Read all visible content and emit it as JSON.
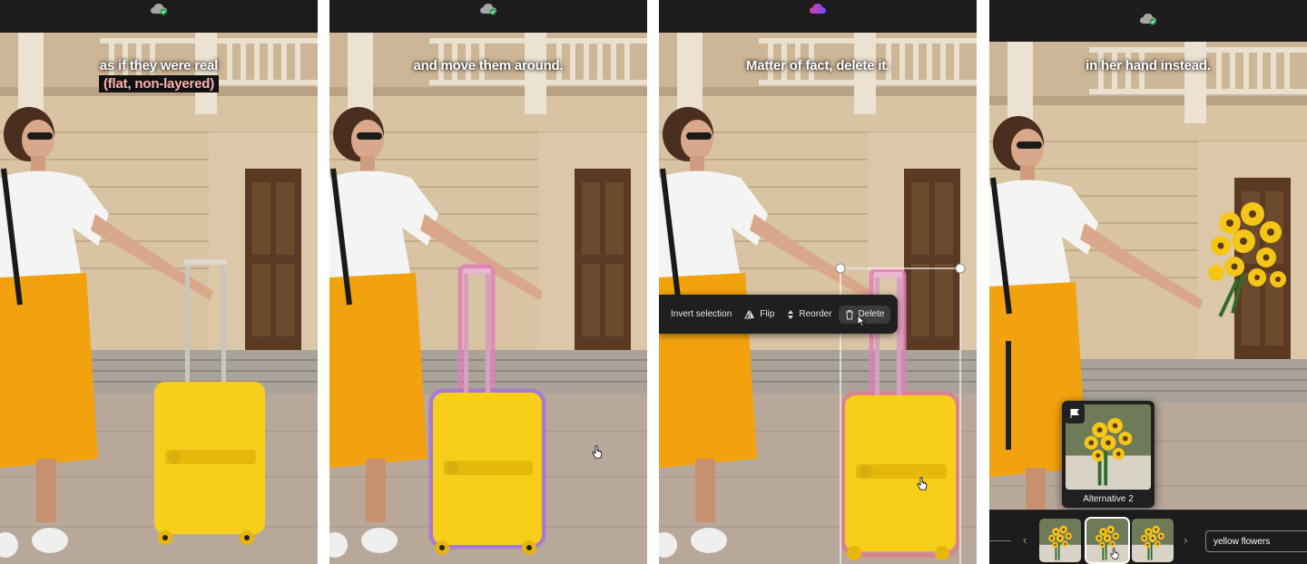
{
  "panels": [
    {
      "caption": "as if they were real",
      "caption_highlight": "(flat, non-layered)"
    },
    {
      "caption": "and move them around."
    },
    {
      "caption": "Matter of fact, delete it."
    },
    {
      "caption": "in her hand instead."
    }
  ],
  "cloud_icons": [
    "cloud-sync-icon",
    "cloud-sync-icon",
    "cloud-syncing-icon",
    "cloud-sync-icon"
  ],
  "toolbar": {
    "invert_selection": "Invert selection",
    "flip": "Flip",
    "reorder": "Reorder",
    "delete": "Delete"
  },
  "alternatives": {
    "label": "Alternative 2"
  },
  "prompt": {
    "value": "yellow flowers"
  },
  "colors": {
    "skirt": "#f3a20f",
    "suitcase": "#f7cf1a",
    "outline_pink": "#e07fb8",
    "outline_purple": "#a371e0"
  }
}
